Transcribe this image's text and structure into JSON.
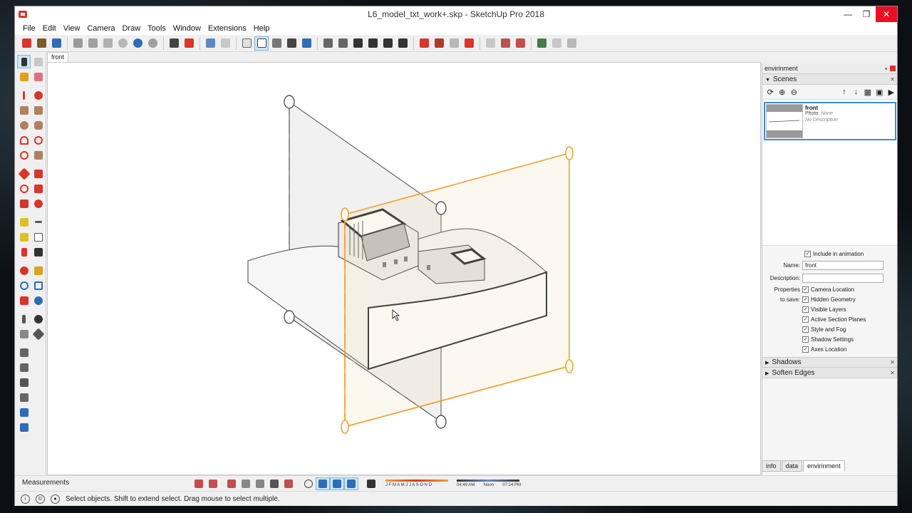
{
  "window": {
    "title": "L6_model_txt_work+.skp - SketchUp Pro 2018"
  },
  "menu": [
    "File",
    "Edit",
    "View",
    "Camera",
    "Draw",
    "Tools",
    "Window",
    "Extensions",
    "Help"
  ],
  "scene_tab": "front",
  "tray": {
    "title": "envirinment",
    "scenes_title": "Scenes",
    "scene": {
      "name": "front",
      "photo": "Photo:",
      "photo_value": "None",
      "description": "No Description"
    },
    "include_in_animation": "Include in animation",
    "name_label": "Name:",
    "name_value": "front",
    "description_label": "Description:",
    "properties_label_1": "Properties",
    "properties_label_2": "to save:",
    "properties": [
      "Camera Location",
      "Hidden Geometry",
      "Visible Layers",
      "Active Section Planes",
      "Style and Fog",
      "Shadow Settings",
      "Axes Location"
    ],
    "shadows_title": "Shadows",
    "soften_title": "Soften Edges",
    "tabs": [
      "info",
      "data",
      "envirinment"
    ]
  },
  "measurements_label": "Measurements",
  "shadow_slider": {
    "months": "J F M A M J J A S O N D",
    "t1": "04:49 AM",
    "t2": "Noon",
    "t3": "07:24 PM"
  },
  "status_text": "Select objects. Shift to extend select. Drag mouse to select multiple.",
  "colors": {
    "section_orange": "#f0a030",
    "selection_blue": "#3c8dd9",
    "close_red": "#e81123"
  }
}
